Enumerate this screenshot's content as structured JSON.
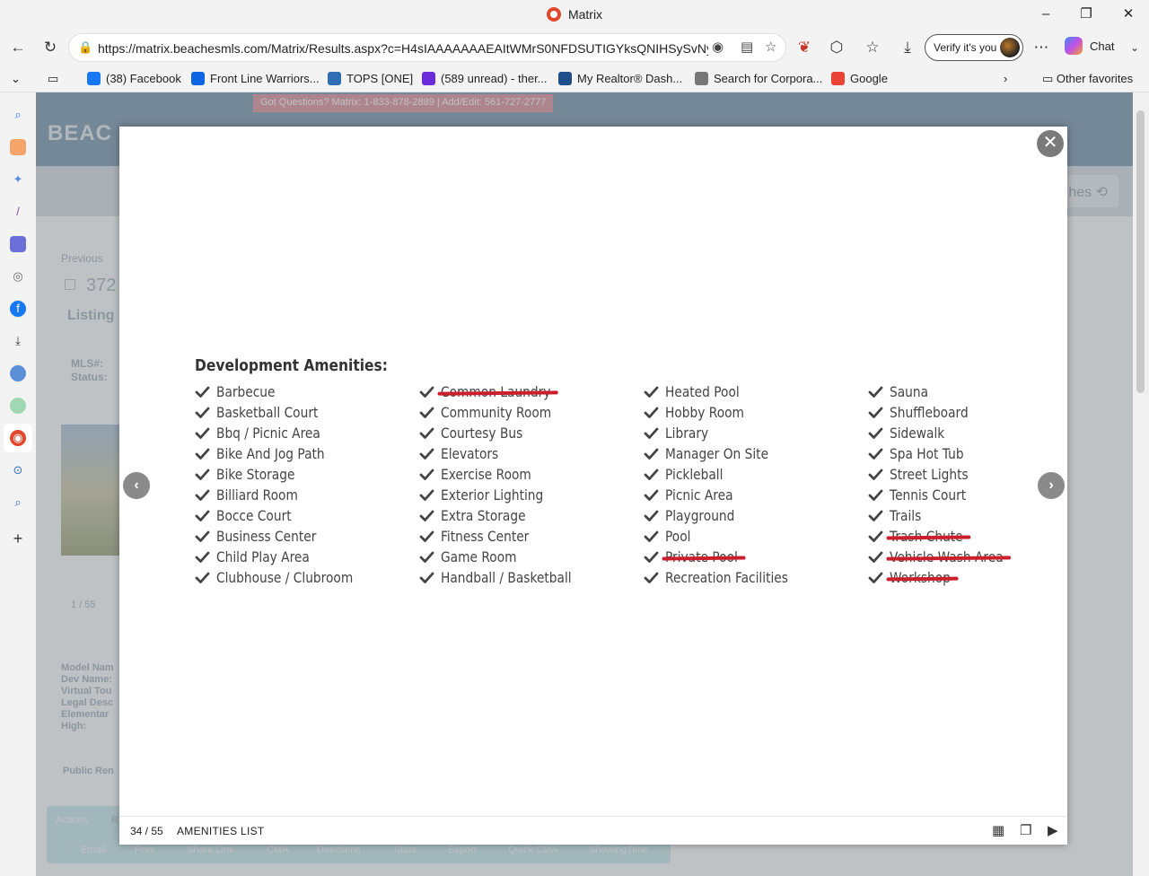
{
  "window": {
    "title": "Matrix"
  },
  "browser": {
    "url": "https://matrix.beachesmls.com/Matrix/Results.aspx?c=H4sIAAAAAAAEAItWMrS0NFDSUTIGYksQNIHSySvNy...",
    "verify_label": "Verify it's you",
    "chat_label": "Chat"
  },
  "favorites": [
    {
      "label": "(38) Facebook",
      "color": "#1877f2"
    },
    {
      "label": "Front Line Warriors...",
      "color": "#0c66e4"
    },
    {
      "label": "TOPS [ONE]",
      "color": "#2f6db5"
    },
    {
      "label": "(589 unread) - ther...",
      "color": "#6b2bd9"
    },
    {
      "label": "My Realtor® Dash...",
      "color": "#1f4e8c"
    },
    {
      "label": "Search for Corpora...",
      "color": "#777777"
    },
    {
      "label": "Google",
      "color": "#ea4335"
    }
  ],
  "other_favorites": "Other favorites",
  "page": {
    "logo": "BEAC",
    "banner": "Got Questions? Matrix: 1-833-878-2889 | Add/Edit: 561-727-2777",
    "searches_fragment": "hes",
    "previous": "Previous",
    "listing_number_fragment": "372",
    "listing_tab": "Listing",
    "mls_label": "MLS#:",
    "status_label": "Status:",
    "photo_counter": "1 / 55",
    "field_labels": [
      "Model Nam",
      "Dev Name:",
      "Virtual Tou",
      "Legal Desc",
      "Elementar",
      "High:"
    ],
    "public_remarks": "Public Ren",
    "actions_tab": "Actions",
    "actions_tab2": "R",
    "action_links": [
      "Email",
      "Print",
      "Share Link",
      "CMA",
      "Directions",
      "Stats",
      "Export",
      "Quick CMA",
      "ShowingTime"
    ]
  },
  "modal": {
    "section_title": "Development Amenities:",
    "columns": [
      [
        {
          "label": "Barbecue",
          "struck": false
        },
        {
          "label": "Basketball Court",
          "struck": false
        },
        {
          "label": "Bbq / Picnic Area",
          "struck": false
        },
        {
          "label": "Bike And Jog Path",
          "struck": false
        },
        {
          "label": "Bike Storage",
          "struck": false
        },
        {
          "label": "Billiard Room",
          "struck": false
        },
        {
          "label": "Bocce Court",
          "struck": false
        },
        {
          "label": "Business Center",
          "struck": false
        },
        {
          "label": "Child Play Area",
          "struck": false
        },
        {
          "label": "Clubhouse / Clubroom",
          "struck": false
        }
      ],
      [
        {
          "label": "Common Laundry",
          "struck": true
        },
        {
          "label": "Community Room",
          "struck": false
        },
        {
          "label": "Courtesy Bus",
          "struck": false
        },
        {
          "label": "Elevators",
          "struck": false
        },
        {
          "label": "Exercise Room",
          "struck": false
        },
        {
          "label": "Exterior Lighting",
          "struck": false
        },
        {
          "label": "Extra Storage",
          "struck": false
        },
        {
          "label": "Fitness Center",
          "struck": false
        },
        {
          "label": "Game Room",
          "struck": false
        },
        {
          "label": "Handball / Basketball",
          "struck": false
        }
      ],
      [
        {
          "label": "Heated Pool",
          "struck": false
        },
        {
          "label": "Hobby Room",
          "struck": false
        },
        {
          "label": "Library",
          "struck": false
        },
        {
          "label": "Manager On Site",
          "struck": false
        },
        {
          "label": "Pickleball",
          "struck": false
        },
        {
          "label": "Picnic Area",
          "struck": false
        },
        {
          "label": "Playground",
          "struck": false
        },
        {
          "label": "Pool",
          "struck": false
        },
        {
          "label": "Private Pool",
          "struck": true
        },
        {
          "label": "Recreation Facilities",
          "struck": false
        }
      ],
      [
        {
          "label": "Sauna",
          "struck": false
        },
        {
          "label": "Shuffleboard",
          "struck": false
        },
        {
          "label": "Sidewalk",
          "struck": false
        },
        {
          "label": "Spa Hot Tub",
          "struck": false
        },
        {
          "label": "Street Lights",
          "struck": false
        },
        {
          "label": "Tennis Court",
          "struck": false
        },
        {
          "label": "Trails",
          "struck": false
        },
        {
          "label": "Trash Chute",
          "struck": true
        },
        {
          "label": "Vehicle Wash Area",
          "struck": true
        },
        {
          "label": "Workshop",
          "struck": true
        }
      ]
    ],
    "counter": "34 / 55",
    "caption": "AMENITIES LIST",
    "strike_color": "#cc1f2d",
    "check_color": "#444444"
  }
}
